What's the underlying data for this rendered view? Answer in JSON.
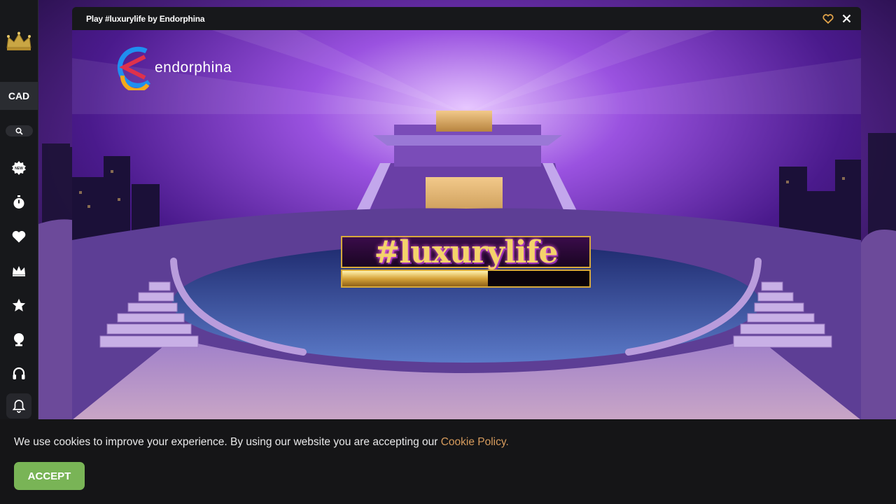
{
  "sidebar": {
    "logo_icon": "crown-icon",
    "currency": "CAD",
    "search_icon": "search-icon",
    "items": [
      {
        "icon": "new-badge-icon"
      },
      {
        "icon": "stopwatch-icon"
      },
      {
        "icon": "heart-icon"
      },
      {
        "icon": "crown-icon"
      },
      {
        "icon": "star-icon"
      },
      {
        "icon": "trophy-icon"
      },
      {
        "icon": "headset-icon"
      },
      {
        "icon": "bell-icon"
      }
    ]
  },
  "modal": {
    "title": "Play #luxurylife by Endorphina",
    "favorite_icon": "heart-outline-icon",
    "close_icon": "close-icon"
  },
  "game": {
    "provider": "endorphina",
    "title": "#luxurylife",
    "loading_progress": 0.59
  },
  "cookie": {
    "text": "We use cookies to improve your experience. By using our website you are accepting our",
    "link": "Cookie Policy.",
    "accept": "ACCEPT"
  },
  "colors": {
    "accent_gold": "#d8a93a",
    "accept_green": "#79b456",
    "link_orange": "#d69b5d",
    "sidebar_bg": "#17181b"
  }
}
